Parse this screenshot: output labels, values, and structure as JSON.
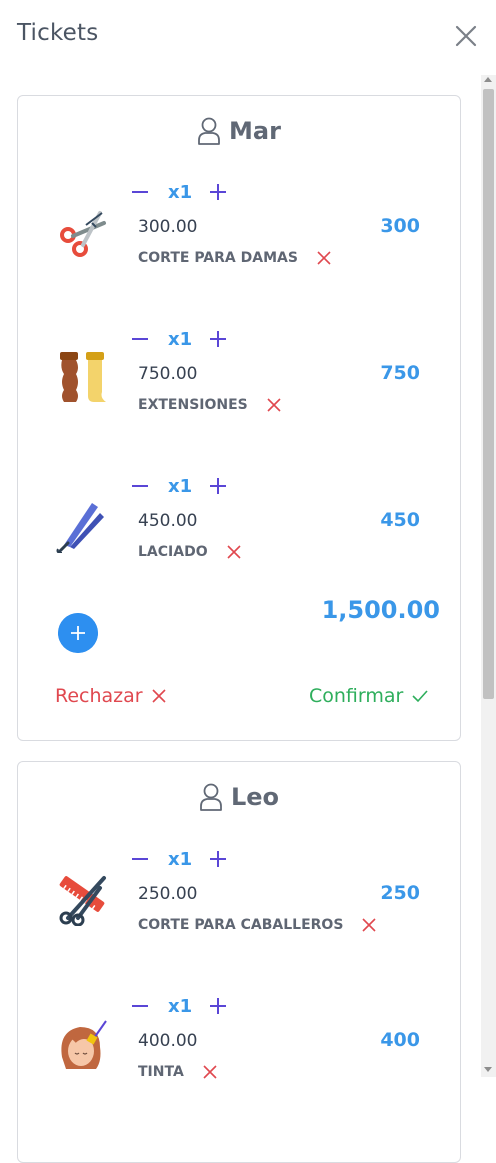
{
  "header": {
    "title": "Tickets"
  },
  "tickets": [
    {
      "client": "Mar",
      "items": [
        {
          "qty": "x1",
          "price": "300.00",
          "subtotal": "300",
          "service": "CORTE PARA DAMAS",
          "icon": "scissors-icon"
        },
        {
          "qty": "x1",
          "price": "750.00",
          "subtotal": "750",
          "service": "EXTENSIONES",
          "icon": "hair-extensions-icon"
        },
        {
          "qty": "x1",
          "price": "450.00",
          "subtotal": "450",
          "service": "LACIADO",
          "icon": "hair-straightener-icon"
        }
      ],
      "total": "1,500.00",
      "reject_label": "Rechazar",
      "confirm_label": "Confirmar"
    },
    {
      "client": "Leo",
      "items": [
        {
          "qty": "x1",
          "price": "250.00",
          "subtotal": "250",
          "service": "CORTE PARA CABALLEROS",
          "icon": "comb-scissors-icon"
        },
        {
          "qty": "x1",
          "price": "400.00",
          "subtotal": "400",
          "service": "TINTA",
          "icon": "hair-dye-icon"
        }
      ]
    }
  ],
  "colors": {
    "accent": "#3a97e8",
    "reject": "#e0484f",
    "confirm": "#2eae5c",
    "qty_controls": "#5a46d6"
  }
}
